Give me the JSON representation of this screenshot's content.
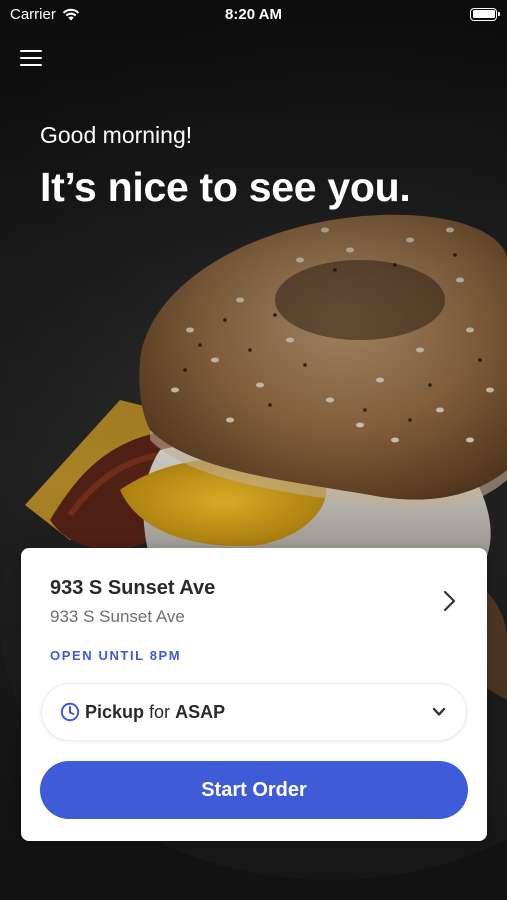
{
  "status_bar": {
    "carrier": "Carrier",
    "time": "8:20 AM",
    "icons": [
      "wifi-icon",
      "battery-icon"
    ]
  },
  "header": {
    "menu_icon": "hamburger-menu-icon",
    "greeting": "Good morning!",
    "headline": "It’s nice to see you."
  },
  "location": {
    "name": "933 S Sunset Ave",
    "address": "933 S Sunset Ave",
    "hours": "OPEN UNTIL 8PM",
    "chevron_icon": "chevron-right-icon"
  },
  "order_mode": {
    "icon": "clock-icon",
    "mode": "Pickup",
    "connector": "for",
    "time": "ASAP",
    "chevron_icon": "chevron-down-icon"
  },
  "actions": {
    "start_order": "Start Order"
  },
  "colors": {
    "accent": "#3f5bd8",
    "card_background": "#ffffff",
    "primary_text": "#2a2a2a",
    "secondary_text": "#6e6e6e"
  }
}
